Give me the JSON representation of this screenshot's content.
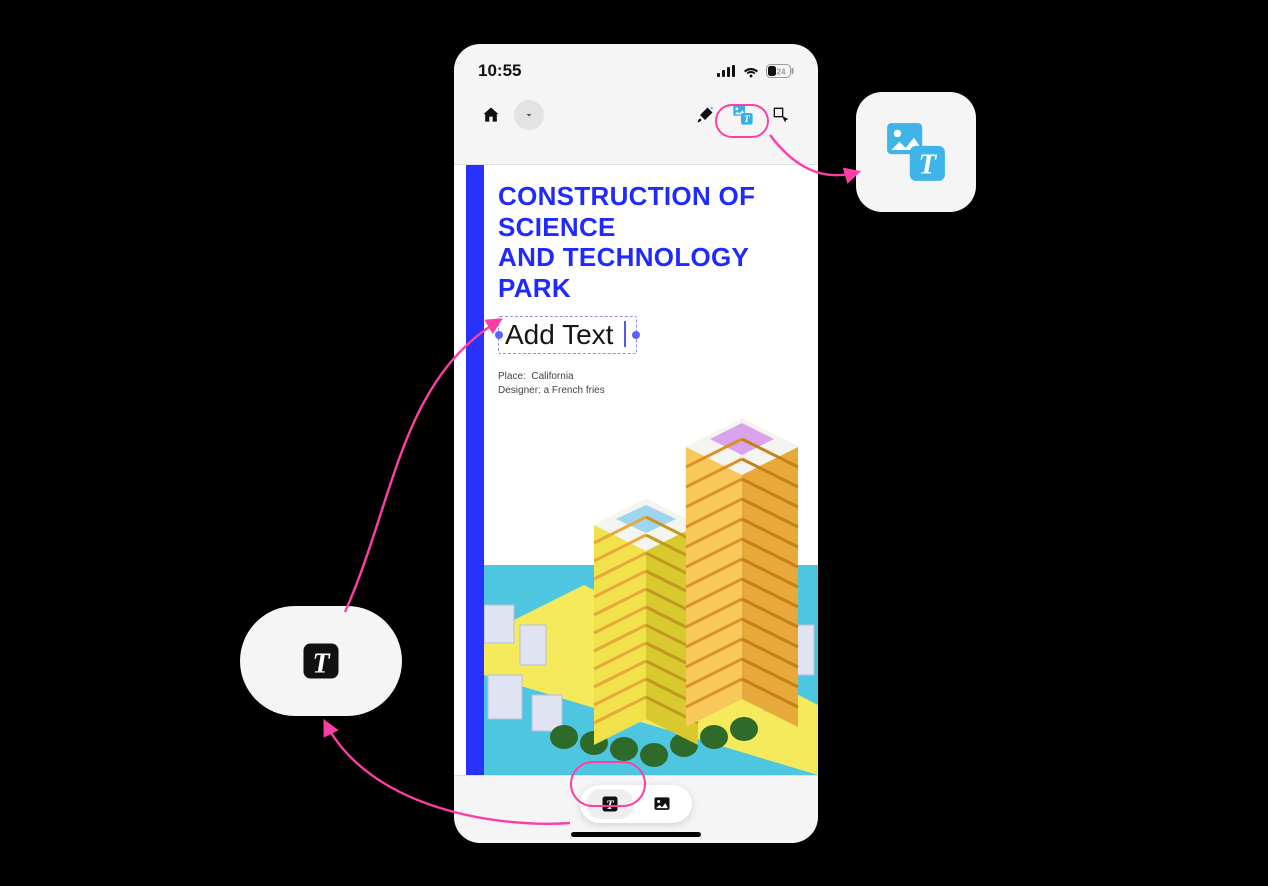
{
  "status": {
    "time": "10:55",
    "battery_label": "24"
  },
  "doc": {
    "heading_line1": "Construction of Science",
    "heading_line2": "and Technology Park",
    "addtext_label": "Add Text",
    "place_label": "Place:",
    "place_value": "California",
    "designer_label": "Designer:",
    "designer_value": "a French fries"
  },
  "icons": {
    "home": "home-icon",
    "down": "chevron-down-icon",
    "highlighter": "highlighter-icon",
    "image_text": "image-text-icon",
    "select": "lasso-select-icon",
    "text_tool": "text-tool-icon",
    "image_tool": "image-tool-icon"
  }
}
